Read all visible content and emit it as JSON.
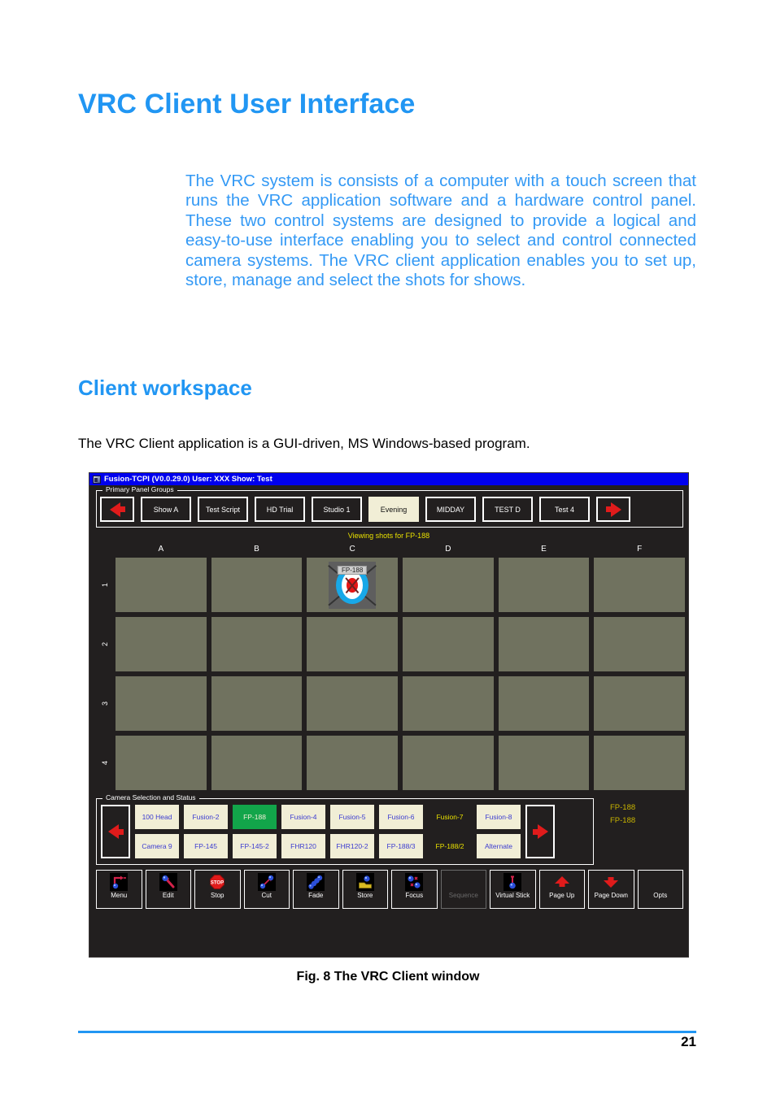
{
  "document": {
    "h1": "VRC Client User Interface",
    "intro": "The VRC system is consists of a computer with a touch screen that runs the VRC application software and a hardware control panel. These two control systems are designed to provide a logical and easy-to-use interface enabling you to select and control connected camera systems. The VRC client application enables you to set up, store, manage and select the shots for shows.",
    "h2": "Client workspace",
    "body_line": "The VRC Client application is a GUI-driven, MS Windows-based program.",
    "figure_caption": "Fig. 8  The VRC Client window",
    "page_number": "21",
    "accent_color": "#2196f3",
    "body_blue": "#3399f5"
  },
  "app": {
    "title": "Fusion-TCPI (V0.0.29.0)  User: XXX  Show: Test",
    "title_icon": "app-window-icon",
    "titlebar_color": "#0000ee",
    "background_color": "#221f1f",
    "panel_groups": {
      "label": "Primary Panel Groups",
      "prev_icon": "arrow-left-icon",
      "next_icon": "arrow-right-icon",
      "items": [
        {
          "label": "Show A",
          "selected": false
        },
        {
          "label": "Test Script",
          "selected": false
        },
        {
          "label": "HD Trial",
          "selected": false
        },
        {
          "label": "Studio 1",
          "selected": false
        },
        {
          "label": "Evening",
          "selected": true
        },
        {
          "label": "MIDDAY",
          "selected": false
        },
        {
          "label": "TEST D",
          "selected": false
        },
        {
          "label": "Test 4",
          "selected": false
        }
      ],
      "selected_color": "#f1eed6"
    },
    "shots": {
      "banner": "Viewing shots for FP-188",
      "banner_color": "#e8e000",
      "columns": [
        "A",
        "B",
        "C",
        "D",
        "E",
        "F"
      ],
      "rows": [
        "1",
        "2",
        "3",
        "4"
      ],
      "cell_color": "#70725f",
      "occupied": [
        {
          "row": "1",
          "column": "C",
          "label": "FP-188",
          "icon": "target-shot-thumbnail"
        }
      ]
    },
    "cameras": {
      "label": "Camera Selection and Status",
      "prev_icon": "arrow-left-icon",
      "next_icon": "arrow-right-icon",
      "columns": [
        {
          "top": {
            "label": "100 Head",
            "state": "normal"
          },
          "bottom": {
            "label": "Camera 9",
            "state": "normal"
          }
        },
        {
          "top": {
            "label": "Fusion-2",
            "state": "normal"
          },
          "bottom": {
            "label": "FP-145",
            "state": "normal"
          }
        },
        {
          "top": {
            "label": "FP-188",
            "state": "active"
          },
          "bottom": {
            "label": "FP-145-2",
            "state": "normal"
          }
        },
        {
          "top": {
            "label": "Fusion-4",
            "state": "normal"
          },
          "bottom": {
            "label": "FHR120",
            "state": "normal"
          }
        },
        {
          "top": {
            "label": "Fusion-5",
            "state": "normal"
          },
          "bottom": {
            "label": "FHR120-2",
            "state": "normal"
          }
        },
        {
          "top": {
            "label": "Fusion-6",
            "state": "normal"
          },
          "bottom": {
            "label": "FP-188/3",
            "state": "normal"
          }
        },
        {
          "top": {
            "label": "Fusion-7",
            "state": "offline"
          },
          "bottom": {
            "label": "FP-188/2",
            "state": "offline"
          }
        },
        {
          "top": {
            "label": "Fusion-8",
            "state": "normal"
          },
          "bottom": {
            "label": "Alternate",
            "state": "normal"
          }
        }
      ],
      "active_color": "#12a54a",
      "button_color": "#f1eed6",
      "offline_color": "#e8e000"
    },
    "status": {
      "lines": [
        "FP-188",
        "FP-188"
      ],
      "color": "#c8b400"
    },
    "toolbar": [
      {
        "label": "Menu",
        "icon": "menu-icon",
        "enabled": true
      },
      {
        "label": "Edit",
        "icon": "wrench-icon",
        "enabled": true
      },
      {
        "label": "Stop",
        "icon": "stop-sign-icon",
        "enabled": true
      },
      {
        "label": "Cut",
        "icon": "cut-transition-icon",
        "enabled": true
      },
      {
        "label": "Fade",
        "icon": "fade-icon",
        "enabled": true
      },
      {
        "label": "Store",
        "icon": "store-icon",
        "enabled": true
      },
      {
        "label": "Focus",
        "icon": "focus-icon",
        "enabled": true
      },
      {
        "label": "Sequence",
        "icon": "sequence-icon",
        "enabled": false
      },
      {
        "label": "Virtual Stick",
        "icon": "joystick-icon",
        "enabled": true
      },
      {
        "label": "Page Up",
        "icon": "arrow-up-icon",
        "enabled": true
      },
      {
        "label": "Page Down",
        "icon": "arrow-down-icon",
        "enabled": true
      },
      {
        "label": "Opts",
        "icon": "options-icon",
        "enabled": true
      }
    ]
  }
}
